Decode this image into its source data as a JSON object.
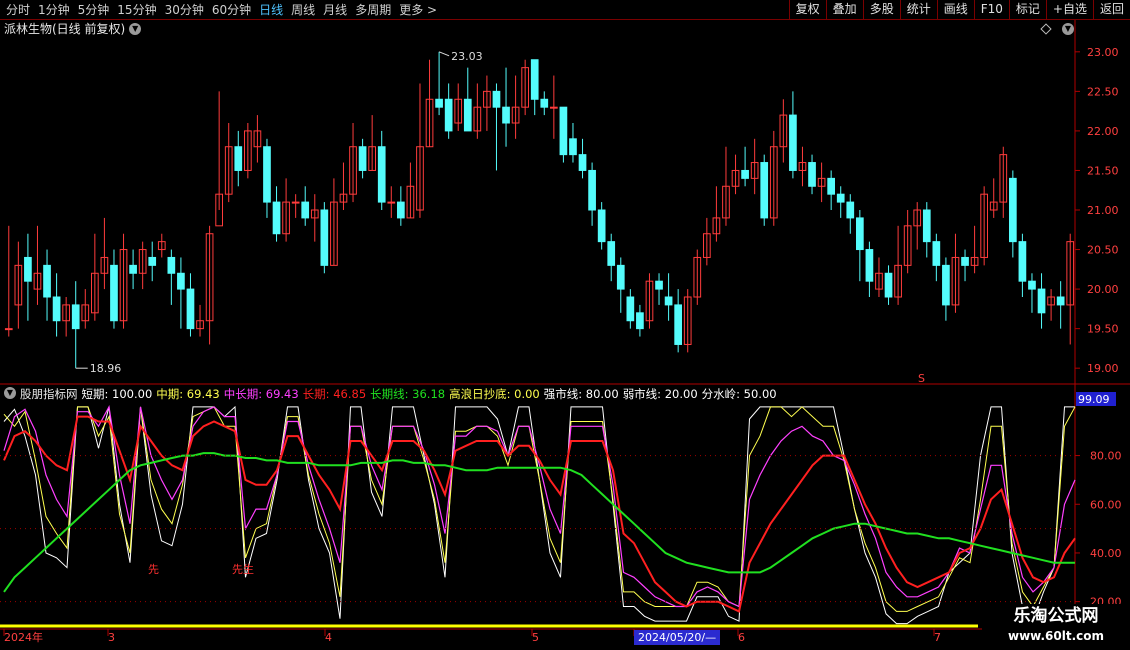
{
  "toolbar": {
    "periods": [
      "分时",
      "1分钟",
      "5分钟",
      "15分钟",
      "30分钟",
      "60分钟",
      "日线",
      "周线",
      "月线",
      "多周期",
      "更多 >"
    ],
    "active_index": 6,
    "right": [
      "复权",
      "叠加",
      "多股",
      "统计",
      "画线",
      "F10",
      "标记",
      "+自选",
      "返回"
    ]
  },
  "stock": {
    "title": "派林生物(日线 前复权)"
  },
  "colors": {
    "up": "#ff3c3c",
    "down": "#54fcfc",
    "axis": "#b00000",
    "short": "#ffffff",
    "mid": "#ffff50",
    "midlong": "#ff40ff",
    "long": "#ff2020",
    "longline": "#20e020",
    "strong": "#ff4040",
    "weak": "#ffffff"
  },
  "price_axis": {
    "ticks": [
      "23.00",
      "22.50",
      "22.00",
      "21.50",
      "21.00",
      "20.50",
      "20.00",
      "19.50",
      "19.00"
    ],
    "min": 18.8,
    "max": 23.2
  },
  "annotations": {
    "high": "23.03",
    "low": "18.96",
    "marker": "S"
  },
  "indicator": {
    "name": "股朋指标网",
    "items": [
      {
        "label": "短期: 100.00",
        "key": "short"
      },
      {
        "label": "中期: 69.43",
        "key": "mid"
      },
      {
        "label": "中长期: 69.43",
        "key": "midlong"
      },
      {
        "label": "长期: 46.85",
        "key": "long"
      },
      {
        "label": "长期线: 36.18",
        "key": "longline"
      },
      {
        "label": "高浪日抄底: 0.00",
        "key": "mid"
      },
      {
        "label": "强市线: 80.00",
        "key": "weak"
      },
      {
        "label": "弱市线: 20.00",
        "key": "weak"
      },
      {
        "label": "分水岭: 50.00",
        "key": "weak"
      }
    ],
    "ticks": [
      "80.00",
      "60.00",
      "40.00",
      "20.00"
    ],
    "current": "99.09",
    "signals": [
      "先",
      "先生"
    ],
    "min": 10,
    "max": 102
  },
  "dates": [
    "2024年",
    "3",
    "4",
    "5",
    "2024/05/20/—",
    "6",
    "7"
  ],
  "logo": {
    "line1": "乐淘公式网",
    "line2": "www.60lt.com"
  },
  "chart_data": {
    "type": "candlestick",
    "title": "派林生物(日线 前复权)",
    "candles": [
      [
        19.5,
        19.5,
        20.8,
        19.4
      ],
      [
        19.8,
        20.3,
        20.6,
        19.5
      ],
      [
        20.4,
        20.1,
        20.7,
        19.6
      ],
      [
        20.0,
        20.2,
        20.8,
        19.8
      ],
      [
        20.3,
        19.9,
        20.5,
        19.6
      ],
      [
        19.9,
        19.6,
        20.2,
        19.4
      ],
      [
        19.6,
        19.8,
        19.9,
        19.4
      ],
      [
        19.8,
        19.5,
        20.1,
        19.0
      ],
      [
        19.6,
        19.8,
        20.0,
        19.5
      ],
      [
        19.7,
        20.2,
        20.7,
        19.6
      ],
      [
        20.2,
        20.4,
        20.9,
        20.0
      ],
      [
        20.3,
        19.6,
        20.5,
        19.5
      ],
      [
        19.6,
        20.5,
        20.7,
        19.5
      ],
      [
        20.3,
        20.2,
        20.5,
        20.0
      ],
      [
        20.2,
        20.5,
        20.6,
        20.0
      ],
      [
        20.4,
        20.3,
        20.6,
        20.1
      ],
      [
        20.5,
        20.6,
        20.7,
        20.4
      ],
      [
        20.4,
        20.2,
        20.5,
        19.8
      ],
      [
        20.2,
        20.0,
        20.4,
        19.5
      ],
      [
        20.0,
        19.5,
        20.2,
        19.4
      ],
      [
        19.5,
        19.6,
        19.8,
        19.4
      ],
      [
        19.6,
        20.7,
        20.8,
        19.3
      ],
      [
        20.8,
        21.2,
        22.5,
        21.0
      ],
      [
        21.2,
        21.8,
        22.1,
        21.1
      ],
      [
        21.8,
        21.5,
        22.0,
        21.3
      ],
      [
        21.5,
        22.0,
        22.1,
        21.4
      ],
      [
        21.8,
        22.0,
        22.2,
        21.6
      ],
      [
        21.8,
        21.1,
        21.9,
        20.9
      ],
      [
        21.1,
        20.7,
        21.3,
        20.6
      ],
      [
        20.7,
        21.1,
        21.4,
        20.6
      ],
      [
        21.1,
        21.1,
        21.2,
        20.9
      ],
      [
        21.1,
        20.9,
        21.3,
        20.8
      ],
      [
        20.9,
        21.0,
        21.2,
        20.6
      ],
      [
        21.0,
        20.3,
        21.1,
        20.2
      ],
      [
        20.3,
        21.1,
        21.4,
        20.3
      ],
      [
        21.1,
        21.2,
        21.6,
        21.0
      ],
      [
        21.2,
        21.8,
        22.1,
        21.1
      ],
      [
        21.8,
        21.5,
        21.9,
        21.4
      ],
      [
        21.5,
        21.8,
        22.2,
        21.5
      ],
      [
        21.8,
        21.1,
        22.0,
        21.0
      ],
      [
        21.1,
        21.1,
        21.3,
        20.9
      ],
      [
        21.1,
        20.9,
        21.3,
        20.8
      ],
      [
        20.9,
        21.3,
        21.6,
        20.9
      ],
      [
        21.0,
        21.8,
        22.6,
        20.9
      ],
      [
        21.8,
        22.4,
        22.9,
        21.8
      ],
      [
        22.4,
        22.3,
        23.0,
        22.2
      ],
      [
        22.4,
        22.0,
        22.6,
        21.9
      ],
      [
        22.1,
        22.4,
        22.6,
        22.0
      ],
      [
        22.4,
        22.0,
        22.8,
        22.0
      ],
      [
        22.0,
        22.3,
        22.6,
        21.9
      ],
      [
        22.3,
        22.5,
        22.7,
        22.0
      ],
      [
        22.5,
        22.3,
        22.6,
        21.5
      ],
      [
        22.3,
        22.1,
        22.8,
        21.8
      ],
      [
        22.1,
        22.3,
        22.7,
        21.9
      ],
      [
        22.3,
        22.8,
        22.9,
        22.2
      ],
      [
        22.9,
        22.4,
        22.9,
        22.2
      ],
      [
        22.4,
        22.3,
        22.5,
        22.2
      ],
      [
        22.3,
        22.3,
        22.7,
        21.9
      ],
      [
        22.3,
        21.7,
        22.3,
        21.6
      ],
      [
        21.9,
        21.7,
        22.1,
        21.6
      ],
      [
        21.7,
        21.5,
        21.9,
        21.4
      ],
      [
        21.5,
        21.0,
        21.6,
        20.8
      ],
      [
        21.0,
        20.6,
        21.1,
        20.5
      ],
      [
        20.6,
        20.3,
        20.7,
        20.1
      ],
      [
        20.3,
        20.0,
        20.4,
        19.7
      ],
      [
        19.9,
        19.6,
        20.0,
        19.5
      ],
      [
        19.7,
        19.5,
        19.8,
        19.4
      ],
      [
        19.6,
        20.1,
        20.2,
        19.5
      ],
      [
        20.1,
        20.0,
        20.2,
        19.8
      ],
      [
        19.9,
        19.8,
        20.2,
        19.6
      ],
      [
        19.8,
        19.3,
        20.0,
        19.2
      ],
      [
        19.3,
        19.9,
        20.0,
        19.2
      ],
      [
        19.9,
        20.4,
        20.5,
        19.8
      ],
      [
        20.4,
        20.7,
        20.9,
        20.3
      ],
      [
        20.7,
        20.9,
        21.3,
        20.6
      ],
      [
        20.9,
        21.3,
        21.8,
        20.8
      ],
      [
        21.3,
        21.5,
        21.7,
        21.2
      ],
      [
        21.5,
        21.4,
        21.8,
        21.3
      ],
      [
        21.4,
        21.6,
        21.9,
        21.2
      ],
      [
        21.6,
        20.9,
        21.7,
        20.8
      ],
      [
        20.9,
        21.8,
        22.0,
        20.8
      ],
      [
        21.8,
        22.2,
        22.4,
        21.6
      ],
      [
        22.2,
        21.5,
        22.5,
        21.4
      ],
      [
        21.5,
        21.6,
        21.8,
        21.3
      ],
      [
        21.6,
        21.3,
        21.7,
        21.2
      ],
      [
        21.3,
        21.4,
        21.6,
        21.1
      ],
      [
        21.4,
        21.2,
        21.5,
        21.0
      ],
      [
        21.2,
        21.1,
        21.3,
        20.9
      ],
      [
        21.1,
        20.9,
        21.2,
        20.7
      ],
      [
        20.9,
        20.5,
        21.0,
        20.1
      ],
      [
        20.5,
        20.1,
        20.6,
        19.9
      ],
      [
        20.0,
        20.2,
        20.4,
        19.9
      ],
      [
        20.2,
        19.9,
        20.3,
        19.8
      ],
      [
        19.9,
        20.3,
        20.8,
        19.8
      ],
      [
        20.3,
        20.8,
        21.0,
        20.2
      ],
      [
        20.8,
        21.0,
        21.1,
        20.5
      ],
      [
        21.0,
        20.6,
        21.1,
        20.4
      ],
      [
        20.6,
        20.3,
        20.7,
        20.1
      ],
      [
        20.3,
        19.8,
        20.4,
        19.6
      ],
      [
        19.8,
        20.4,
        20.7,
        19.7
      ],
      [
        20.4,
        20.3,
        20.5,
        20.1
      ],
      [
        20.3,
        20.4,
        20.8,
        20.2
      ],
      [
        20.4,
        21.2,
        21.3,
        20.3
      ],
      [
        21.0,
        21.1,
        21.4,
        20.9
      ],
      [
        21.1,
        21.7,
        21.8,
        20.9
      ],
      [
        21.4,
        20.6,
        21.5,
        20.4
      ],
      [
        20.6,
        20.1,
        20.7,
        19.9
      ],
      [
        20.1,
        20.0,
        20.2,
        19.7
      ],
      [
        20.0,
        19.7,
        20.2,
        19.5
      ],
      [
        19.8,
        19.9,
        20.0,
        19.6
      ],
      [
        19.9,
        19.8,
        20.1,
        19.5
      ],
      [
        19.8,
        20.6,
        20.7,
        19.3
      ]
    ],
    "indicator_series": [
      {
        "name": "短期",
        "values": [
          94,
          99,
          88,
          72,
          40,
          38,
          34,
          100,
          100,
          83,
          100,
          60,
          36,
          100,
          64,
          45,
          43,
          60,
          100,
          100,
          100,
          96,
          100,
          30,
          46,
          48,
          70,
          100,
          100,
          70,
          50,
          40,
          13,
          100,
          100,
          65,
          55,
          100,
          100,
          100,
          80,
          60,
          30,
          100,
          100,
          100,
          100,
          95,
          80,
          100,
          100,
          70,
          40,
          30,
          100,
          100,
          100,
          100,
          60,
          18,
          18,
          14,
          12,
          12,
          12,
          12,
          22,
          22,
          22,
          14,
          12,
          95,
          100,
          100,
          100,
          100,
          100,
          100,
          100,
          100,
          80,
          58,
          40,
          30,
          15,
          11,
          11,
          14,
          16,
          18,
          32,
          36,
          40,
          80,
          100,
          100,
          40,
          18,
          12,
          24,
          34,
          100,
          100
        ]
      },
      {
        "name": "中期",
        "values": [
          97,
          92,
          98,
          78,
          55,
          48,
          42,
          100,
          100,
          88,
          96,
          56,
          40,
          100,
          70,
          58,
          52,
          68,
          96,
          98,
          100,
          92,
          92,
          38,
          50,
          52,
          72,
          96,
          96,
          72,
          56,
          44,
          22,
          92,
          92,
          70,
          60,
          92,
          92,
          92,
          78,
          62,
          36,
          90,
          90,
          92,
          92,
          88,
          76,
          92,
          92,
          70,
          46,
          36,
          94,
          94,
          94,
          94,
          62,
          24,
          24,
          20,
          18,
          18,
          18,
          18,
          28,
          28,
          26,
          20,
          18,
          80,
          88,
          100,
          100,
          96,
          100,
          96,
          92,
          92,
          78,
          58,
          44,
          34,
          20,
          16,
          16,
          18,
          20,
          22,
          30,
          38,
          36,
          62,
          92,
          92,
          44,
          24,
          18,
          26,
          34,
          92,
          100
        ]
      },
      {
        "name": "中长期",
        "values": [
          82,
          96,
          99,
          90,
          72,
          62,
          55,
          98,
          98,
          92,
          100,
          72,
          52,
          100,
          80,
          70,
          62,
          70,
          92,
          98,
          100,
          96,
          96,
          50,
          58,
          58,
          72,
          94,
          94,
          76,
          62,
          50,
          36,
          92,
          92,
          76,
          66,
          92,
          92,
          92,
          82,
          68,
          48,
          88,
          88,
          92,
          92,
          90,
          80,
          92,
          92,
          76,
          58,
          48,
          92,
          92,
          92,
          92,
          68,
          32,
          30,
          26,
          22,
          20,
          18,
          18,
          24,
          26,
          24,
          20,
          18,
          62,
          72,
          80,
          86,
          90,
          92,
          88,
          86,
          80,
          78,
          68,
          56,
          46,
          32,
          26,
          22,
          22,
          24,
          26,
          32,
          42,
          40,
          58,
          76,
          76,
          48,
          30,
          24,
          28,
          34,
          60,
          70
        ]
      },
      {
        "name": "长期",
        "values": [
          78,
          88,
          90,
          86,
          80,
          76,
          74,
          96,
          96,
          94,
          94,
          82,
          70,
          92,
          86,
          80,
          76,
          74,
          88,
          92,
          94,
          92,
          90,
          70,
          68,
          68,
          74,
          88,
          88,
          80,
          72,
          66,
          58,
          86,
          86,
          80,
          74,
          86,
          86,
          86,
          82,
          74,
          64,
          82,
          84,
          86,
          86,
          86,
          80,
          84,
          84,
          78,
          70,
          64,
          86,
          86,
          86,
          86,
          74,
          48,
          44,
          36,
          28,
          24,
          20,
          18,
          20,
          20,
          20,
          18,
          16,
          36,
          44,
          52,
          58,
          64,
          70,
          76,
          80,
          80,
          80,
          70,
          60,
          52,
          42,
          34,
          28,
          26,
          28,
          30,
          32,
          40,
          42,
          50,
          62,
          66,
          52,
          38,
          30,
          28,
          30,
          40,
          46
        ]
      },
      {
        "name": "长期线",
        "values": [
          24,
          30,
          34,
          38,
          42,
          46,
          50,
          54,
          58,
          62,
          66,
          70,
          74,
          76,
          77,
          78,
          79,
          80,
          80,
          81,
          81,
          80,
          80,
          79,
          79,
          78,
          78,
          77,
          77,
          77,
          76,
          76,
          76,
          76,
          77,
          77,
          77,
          78,
          78,
          77,
          77,
          76,
          76,
          75,
          74,
          74,
          74,
          75,
          75,
          75,
          75,
          75,
          75,
          75,
          74,
          72,
          68,
          64,
          60,
          56,
          52,
          48,
          44,
          40,
          38,
          36,
          35,
          34,
          33,
          32,
          32,
          32,
          32,
          34,
          37,
          40,
          43,
          46,
          48,
          50,
          51,
          52,
          52,
          51,
          50,
          49,
          48,
          48,
          47,
          46,
          46,
          45,
          44,
          43,
          42,
          41,
          40,
          39,
          38,
          37,
          36,
          36,
          36
        ]
      }
    ],
    "reference_lines": [
      80,
      20,
      50
    ]
  }
}
